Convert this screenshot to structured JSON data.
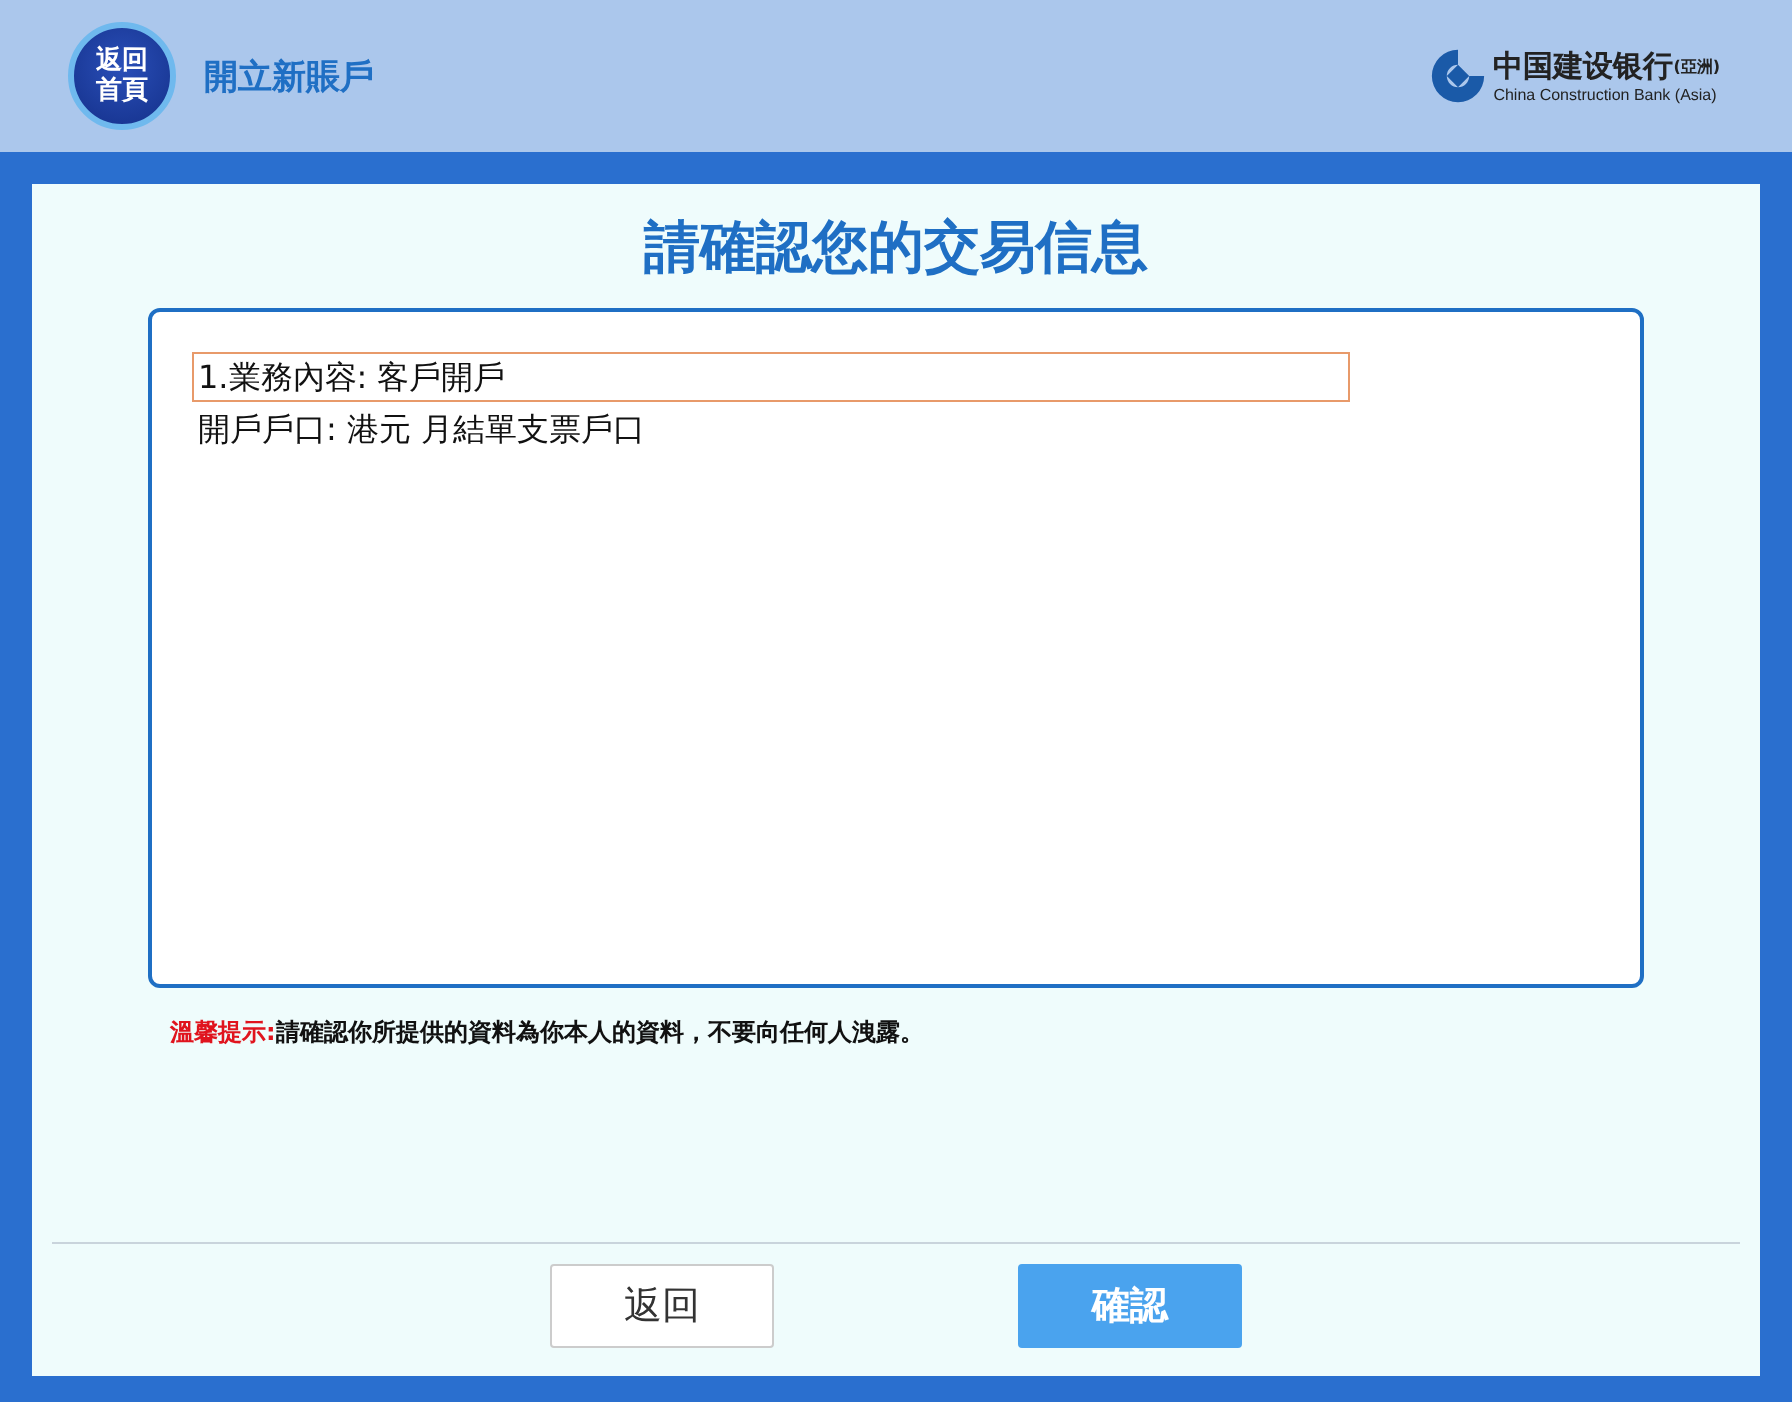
{
  "header": {
    "home_button": [
      "返回",
      "首頁"
    ],
    "title": "開立新賬戶",
    "logo": {
      "name_cn": "中国建设银行",
      "region": "(亞洲)",
      "name_en": "China Construction Bank (Asia)"
    }
  },
  "heading": "請確認您的交易信息",
  "details": [
    {
      "text": "1.業務內容:  客戶開戶",
      "selected": true
    },
    {
      "text": "開戶戶口:  港元 月結單支票戶口",
      "selected": false
    }
  ],
  "notice": {
    "label": "溫馨提示:",
    "text": "請確認你所提供的資料為你本人的資料，不要向任何人洩露。"
  },
  "buttons": [
    {
      "label": "返回",
      "kind": "secondary"
    },
    {
      "label": "確認",
      "kind": "primary"
    }
  ]
}
